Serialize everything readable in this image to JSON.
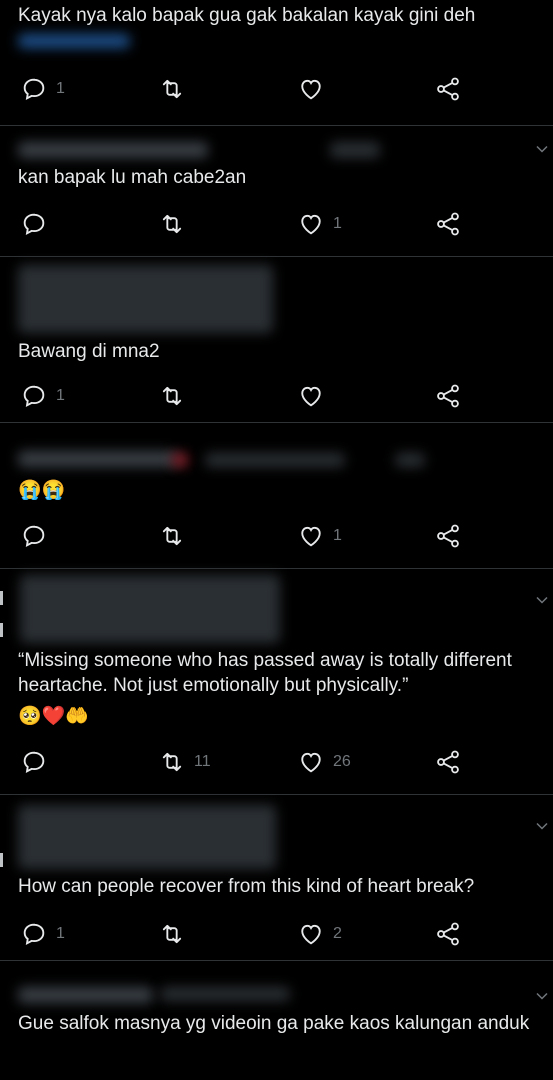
{
  "theme": {
    "background": "#000000",
    "text": "#e7e9ea",
    "muted": "#71767b",
    "divider": "#2f3336"
  },
  "icons": {
    "reply": "reply-icon",
    "retweet": "retweet-icon",
    "like": "heart-icon",
    "share": "share-icon",
    "more": "chevron-down-icon"
  },
  "tweets": [
    {
      "text": "Kayak nya kalo bapak gua gak bakalan kayak gini deh",
      "replies": "1",
      "retweets": "",
      "likes": ""
    },
    {
      "text": "kan bapak lu mah cabe2an",
      "replies": "",
      "retweets": "",
      "likes": "1"
    },
    {
      "text": "Bawang di mna2",
      "replies": "1",
      "retweets": "",
      "likes": ""
    },
    {
      "text": "😭😭",
      "replies": "",
      "retweets": "",
      "likes": "1"
    },
    {
      "text": "“Missing someone who has passed away is totally different heartache. Not just emotionally but physically.”",
      "emoji": "🥺❤️🤲",
      "replies": "",
      "retweets": "11",
      "likes": "26"
    },
    {
      "text": "How can people recover from this kind of heart break?",
      "replies": "1",
      "retweets": "",
      "likes": "2"
    },
    {
      "text": "Gue salfok masnya yg videoin ga pake kaos kalungan anduk"
    }
  ]
}
